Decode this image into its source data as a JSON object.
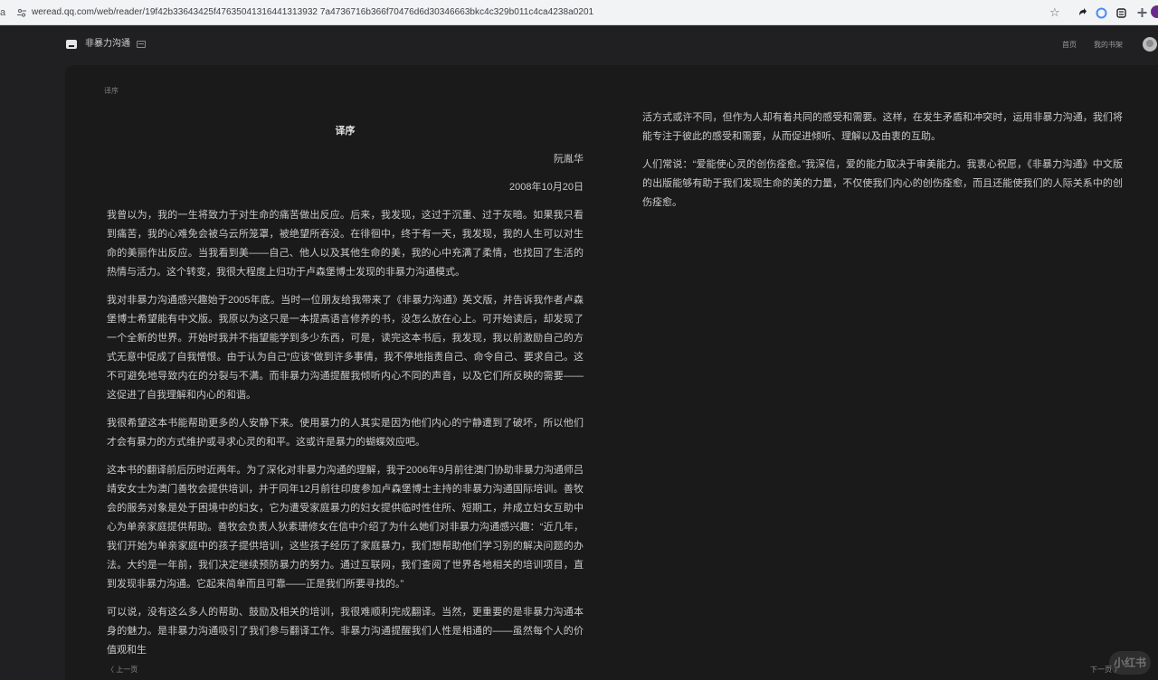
{
  "browser": {
    "site_info": "a",
    "url": "weread.qq.com/web/reader/19f42b33643425f47635041316441313932 7a4736716b366f70476d6d30346663bkc4c329b011c4ca4238a0201"
  },
  "header": {
    "book_title": "非暴力沟通",
    "nav_home": "首页",
    "nav_shelf": "我的书架"
  },
  "reader": {
    "chapter_tag": "译序",
    "title": "译序",
    "author": "阮胤华",
    "date": "2008年10月20日",
    "paragraphs_left": [
      "我曾以为，我的一生将致力于对生命的痛苦做出反应。后来，我发现，这过于沉重、过于灰暗。如果我只看到痛苦，我的心难免会被乌云所笼罩，被绝望所吞没。在徘徊中，终于有一天，我发现，我的人生可以对生命的美丽作出反应。当我看到美——自己、他人以及其他生命的美，我的心中充满了柔情，也找回了生活的热情与活力。这个转变，我很大程度上归功于卢森堡博士发现的非暴力沟通模式。",
      "我对非暴力沟通感兴趣始于2005年底。当时一位朋友给我带来了《非暴力沟通》英文版，并告诉我作者卢森堡博士希望能有中文版。我原以为这只是一本提高语言修养的书，没怎么放在心上。可开始读后，却发现了一个全新的世界。开始时我并不指望能学到多少东西，可是，读完这本书后，我发现，我以前激励自己的方式无意中促成了自我憎恨。由于认为自己“应该”做到许多事情，我不停地指责自己、命令自己、要求自己。这不可避免地导致内在的分裂与不满。而非暴力沟通提醒我倾听内心不同的声音，以及它们所反映的需要——这促进了自我理解和内心的和谐。",
      "我很希望这本书能帮助更多的人安静下来。使用暴力的人其实是因为他们内心的宁静遭到了破坏，所以他们才会有暴力的方式维护或寻求心灵的和平。这或许是暴力的蝴蝶效应吧。",
      "这本书的翻译前后历时近两年。为了深化对非暴力沟通的理解，我于2006年9月前往澳门协助非暴力沟通师吕靖安女士为澳门善牧会提供培训，并于同年12月前往印度参加卢森堡博士主持的非暴力沟通国际培训。善牧会的服务对象是处于困境中的妇女，它为遭受家庭暴力的妇女提供临时性住所、短期工，并成立妇女互助中心为单亲家庭提供帮助。善牧会负责人狄素珊修女在信中介绍了为什么她们对非暴力沟通感兴趣：“近几年，我们开始为单亲家庭中的孩子提供培训，这些孩子经历了家庭暴力，我们想帮助他们学习别的解决问题的办法。大约是一年前，我们决定继续预防暴力的努力。通过互联网，我们查阅了世界各地相关的培训项目，直到发现非暴力沟通。它起来简单而且可靠——正是我们所要寻找的。”",
      "可以说，没有这么多人的帮助、鼓励及相关的培训，我很难顺利完成翻译。当然，更重要的是非暴力沟通本身的魅力。是非暴力沟通吸引了我们参与翻译工作。非暴力沟通提醒我们人性是相通的——虽然每个人的价值观和生"
    ],
    "paragraphs_right": [
      "活方式或许不同，但作为人却有着共同的感受和需要。这样，在发生矛盾和冲突时，运用非暴力沟通，我们将能专注于彼此的感受和需要，从而促进倾听、理解以及由衷的互助。",
      "人们常说：“爱能使心灵的创伤痊愈。”我深信，爱的能力取决于审美能力。我衷心祝愿，《非暴力沟通》中文版的出版能够有助于我们发现生命的美的力量，不仅使我们内心的创伤痊愈，而且还能使我们的人际关系中的创伤痊愈。"
    ],
    "prev_label": "〈 上一页",
    "next_label": "下一页 〉",
    "watermark": "小红书"
  },
  "colors": {
    "page_bg": "#202022",
    "reader_bg": "#1a1a1b",
    "text": "#c9c9c9",
    "browser_bar": "#f1f3f4"
  },
  "icons": [
    "tune-icon",
    "star-icon",
    "extension-icon",
    "book-icon",
    "toc-icon",
    "avatar"
  ]
}
